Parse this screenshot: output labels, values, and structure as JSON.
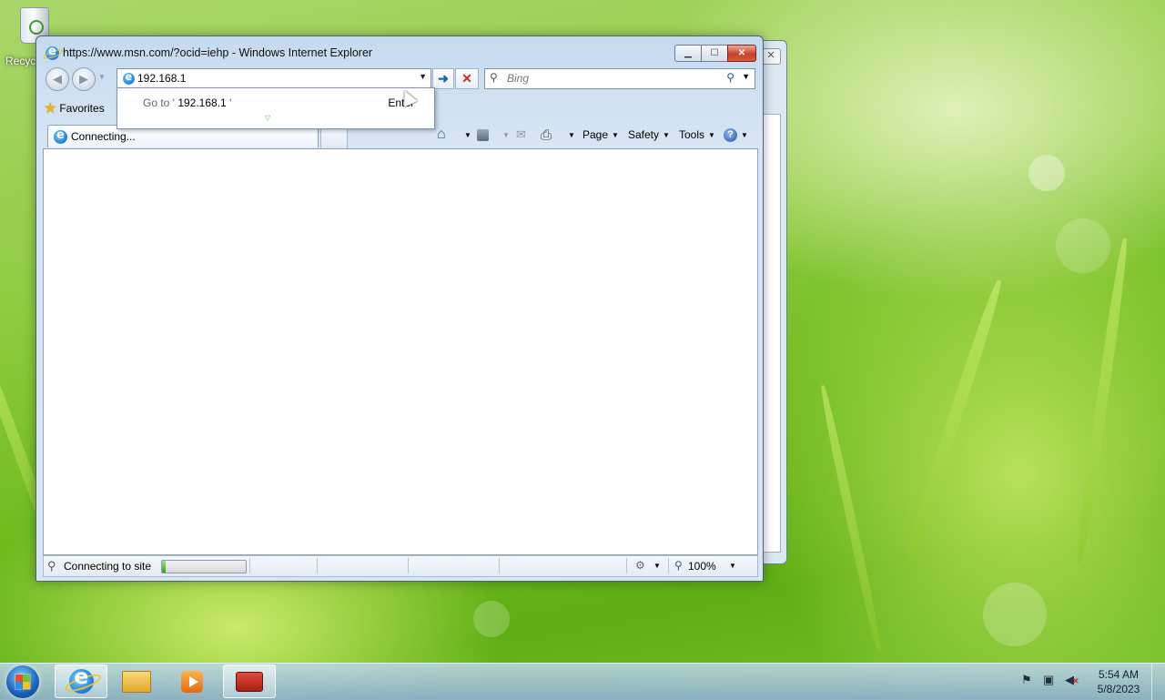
{
  "desktop": {
    "recycle_bin_label": "Recyc"
  },
  "browser": {
    "window_title": "https://www.msn.com/?ocid=iehp - Windows Internet Explorer",
    "address_value": "192.168.1",
    "search_placeholder": "Bing",
    "favorites_label": "Favorites",
    "tab_title": "Connecting...",
    "autocomplete": {
      "goto_prefix": "Go to '",
      "goto_value": "192.168.1",
      "goto_suffix": "'",
      "enter_hint": "Enter"
    },
    "command_bar": {
      "page_label": "Page",
      "safety_label": "Safety",
      "tools_label": "Tools"
    },
    "status": {
      "text": "Connecting to site",
      "progress": 0.04,
      "zoom": "100%"
    }
  },
  "taskbar": {
    "apps": [
      "internet-explorer",
      "windows-explorer",
      "windows-media-player",
      "toolbox"
    ],
    "active_app": "internet-explorer",
    "clock_time": "5:54 AM",
    "clock_date": "5/8/2023"
  }
}
